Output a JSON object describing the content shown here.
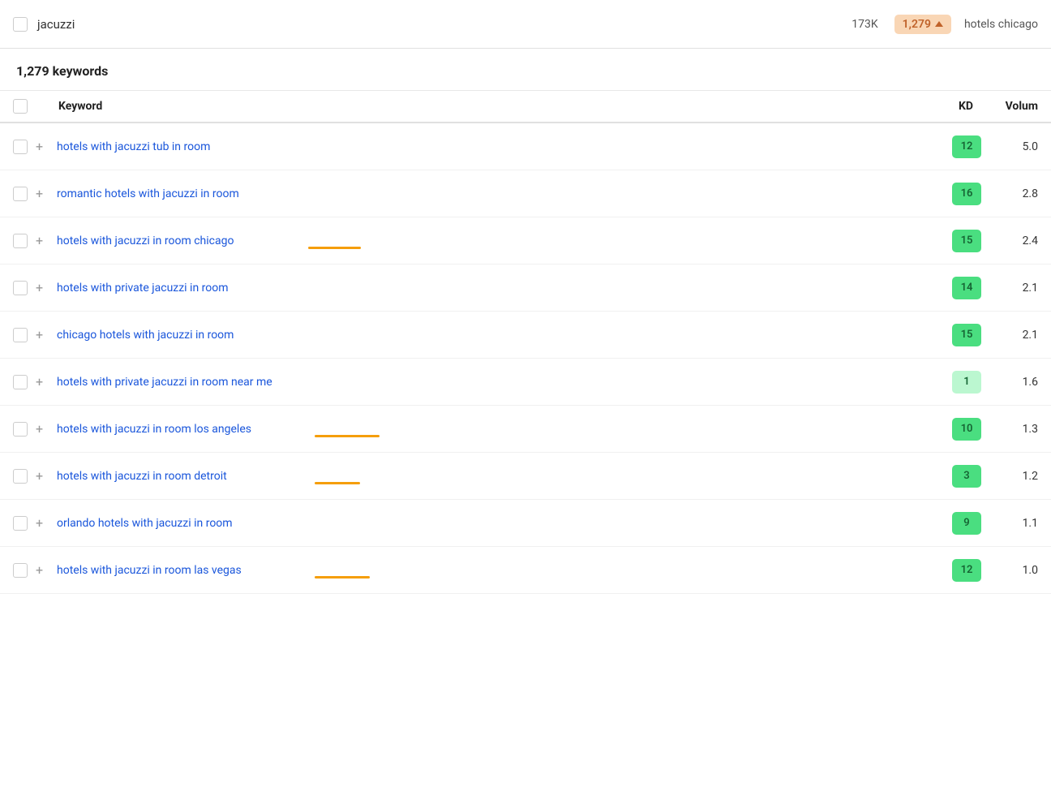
{
  "topBar": {
    "keyword": "jacuzzi",
    "volume": "173K",
    "badge": "1,279",
    "rightText": "hotels chicago"
  },
  "keywordsCount": "1,279 keywords",
  "tableHeader": {
    "keywordCol": "Keyword",
    "kdCol": "KD",
    "volumeCol": "Volum"
  },
  "rows": [
    {
      "keyword": "hotels with jacuzzi tub in room",
      "kd": "12",
      "volume": "5.0",
      "underline": false,
      "underlineStart": 0,
      "underlineWidth": 0
    },
    {
      "keyword": "romantic hotels with jacuzzi in room",
      "kd": "16",
      "volume": "2.8",
      "underline": false,
      "underlineStart": 0,
      "underlineWidth": 0
    },
    {
      "keyword": "hotels with jacuzzi in room chicago",
      "kd": "15",
      "volume": "2.4",
      "underline": true,
      "underlineWord": "chicago",
      "underlineOffset": "310px",
      "underlineWidth": "65px"
    },
    {
      "keyword": "hotels with private jacuzzi in room",
      "kd": "14",
      "volume": "2.1",
      "underline": false
    },
    {
      "keyword": "chicago hotels with jacuzzi in room",
      "kd": "15",
      "volume": "2.1",
      "underline": false
    },
    {
      "keyword": "hotels with private jacuzzi in room near me",
      "kd": "1",
      "volume": "1.6",
      "underline": false,
      "kdVariant": "kd-1"
    },
    {
      "keyword": "hotels with jacuzzi in room los angeles",
      "kd": "10",
      "volume": "1.3",
      "underline": true,
      "underlineOffset": "318px",
      "underlineWidth": "80px"
    },
    {
      "keyword": "hotels with jacuzzi in room detroit",
      "kd": "3",
      "volume": "1.2",
      "underline": true,
      "underlineOffset": "318px",
      "underlineWidth": "56px"
    },
    {
      "keyword": "orlando hotels with jacuzzi in room",
      "kd": "9",
      "volume": "1.1",
      "underline": false
    },
    {
      "keyword": "hotels with jacuzzi in room las vegas",
      "kd": "12",
      "volume": "1.0",
      "underline": true,
      "underlineOffset": "318px",
      "underlineWidth": "68px"
    }
  ]
}
